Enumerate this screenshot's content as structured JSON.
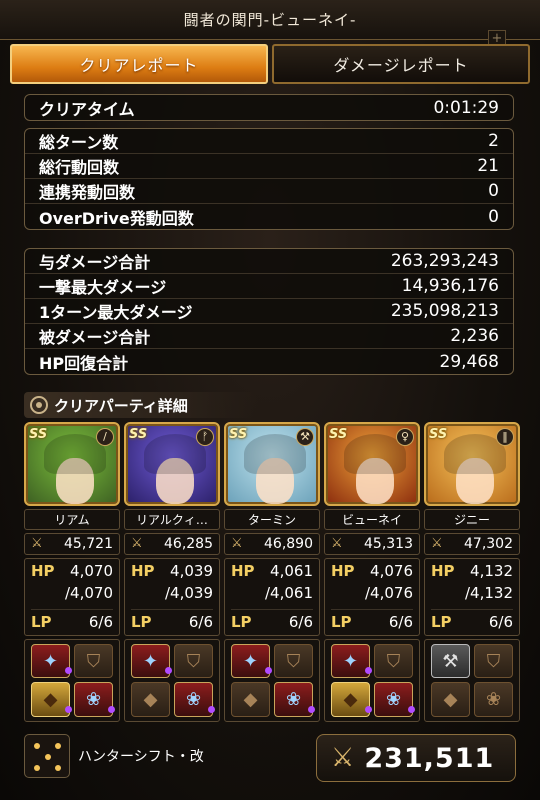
{
  "window": {
    "title": "闘者の関門-ビューネイ-"
  },
  "tabs": [
    {
      "label": "クリアレポート",
      "active": true
    },
    {
      "label": "ダメージレポート",
      "active": false
    }
  ],
  "summary": {
    "clear_time": {
      "label": "クリアタイム",
      "value": "0:01:29"
    },
    "counts": [
      {
        "label": "総ターン数",
        "value": "2"
      },
      {
        "label": "総行動回数",
        "value": "21"
      },
      {
        "label": "連携発動回数",
        "value": "0"
      },
      {
        "label": "OverDrive発動回数",
        "value": "0"
      }
    ],
    "damage": [
      {
        "label": "与ダメージ合計",
        "value": "263,293,243"
      },
      {
        "label": "一撃最大ダメージ",
        "value": "14,936,176"
      },
      {
        "label": "1ターン最大ダメージ",
        "value": "235,098,213"
      },
      {
        "label": "被ダメージ合計",
        "value": "2,236"
      },
      {
        "label": "HP回復合計",
        "value": "29,468"
      }
    ]
  },
  "party": {
    "header": "クリアパーティ詳細",
    "members": [
      {
        "name": "リアム",
        "rarity": "SS",
        "weapon_icon": "sword-icon",
        "power": "45,721",
        "hp_label": "HP",
        "hp": "4,070",
        "hp_max": "/4,070",
        "lp_label": "LP",
        "lp": "6/6",
        "colors": [
          "#7cbf3c",
          "#3c5e22"
        ]
      },
      {
        "name": "リアルクィ…",
        "rarity": "SS",
        "weapon_icon": "axe-icon",
        "power": "46,285",
        "hp_label": "HP",
        "hp": "4,039",
        "hp_max": "/4,039",
        "lp_label": "LP",
        "lp": "6/6",
        "colors": [
          "#6f5bd6",
          "#2a1f66"
        ]
      },
      {
        "name": "ターミン",
        "rarity": "SS",
        "weapon_icon": "club-icon",
        "power": "46,890",
        "hp_label": "HP",
        "hp": "4,061",
        "hp_max": "/4,061",
        "lp_label": "LP",
        "lp": "6/6",
        "colors": [
          "#bfe3ee",
          "#6aa0b8"
        ]
      },
      {
        "name": "ビューネイ",
        "rarity": "SS",
        "weapon_icon": "staff-icon",
        "power": "45,313",
        "hp_label": "HP",
        "hp": "4,076",
        "hp_max": "/4,076",
        "lp_label": "LP",
        "lp": "6/6",
        "colors": [
          "#f0a33a",
          "#8a2b0d"
        ]
      },
      {
        "name": "ジニー",
        "rarity": "SS",
        "weapon_icon": "bow-icon",
        "power": "47,302",
        "hp_label": "HP",
        "hp": "4,132",
        "hp_max": "/4,132",
        "lp_label": "LP",
        "lp": "6/6",
        "colors": [
          "#f6c25a",
          "#b86a1a"
        ]
      }
    ]
  },
  "footer": {
    "formation_name": "ハンターシフト・改",
    "total_power": "231,511"
  }
}
